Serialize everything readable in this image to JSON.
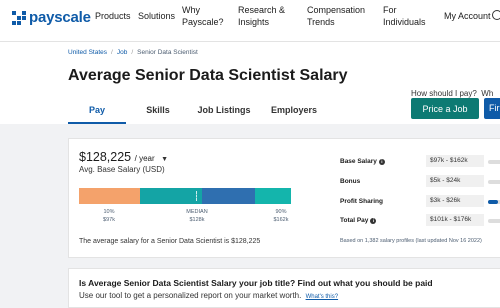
{
  "brand": {
    "name": "payscale",
    "color": "#0f5ba8"
  },
  "nav": {
    "items": [
      {
        "label": "Products"
      },
      {
        "label": "Solutions"
      },
      {
        "label_l1": "Why",
        "label_l2": "Payscale?"
      },
      {
        "label_l1": "Research &",
        "label_l2": "Insights"
      },
      {
        "label_l1": "Compensation",
        "label_l2": "Trends"
      },
      {
        "label_l1": "For",
        "label_l2": "Individuals"
      },
      {
        "label": "My Account"
      }
    ],
    "search_icon": "search-icon"
  },
  "breadcrumb": [
    "United States",
    "Job",
    "Senior Data Scientist"
  ],
  "page_title": "Average Senior Data Scientist Salary",
  "tabs": [
    {
      "label": "Pay",
      "active": true
    },
    {
      "label": "Skills",
      "active": false
    },
    {
      "label": "Job Listings",
      "active": false
    },
    {
      "label": "Employers",
      "active": false
    }
  ],
  "cta": {
    "how_label": "How should I pay?",
    "how_label2": "Wh",
    "price_button": "Price a Job",
    "second_button": "Fir"
  },
  "salary": {
    "amount": "$128,225",
    "period": "/ year",
    "label": "Avg. Base Salary (USD)",
    "sentence": "The average salary for a Senior Data Scientist is $128,225",
    "bar_colors": [
      "#f4a26b",
      "#14a4a5",
      "#2f6fb0",
      "#14b5ac"
    ],
    "bar_fractions": [
      0.29,
      0.29,
      0.25,
      0.17
    ],
    "percentiles": [
      {
        "pct": "10%",
        "value": "$97k"
      },
      {
        "pct": "MEDIAN",
        "value": "$128k"
      },
      {
        "pct": "90%",
        "value": "$162k"
      }
    ]
  },
  "stats": [
    {
      "label": "Base Salary",
      "info": true,
      "range": "$97k - $162k",
      "fill": 0.0
    },
    {
      "label": "Bonus",
      "info": false,
      "range": "$5k - $24k",
      "fill": 0.0
    },
    {
      "label": "Profit Sharing",
      "info": false,
      "range": "$3k - $26k",
      "fill": 0.4
    },
    {
      "label": "Total Pay",
      "info": true,
      "range": "$101k - $176k",
      "fill": 0.0
    }
  ],
  "based_on": "Based on 1,382 salary profiles (last updated Nov 16 2022)",
  "bottom": {
    "title": "Is Average Senior Data Scientist Salary your job title? Find out what you should be paid",
    "subtitle": "Use our tool to get a personalized report on your market worth.",
    "link": "What's this?"
  }
}
